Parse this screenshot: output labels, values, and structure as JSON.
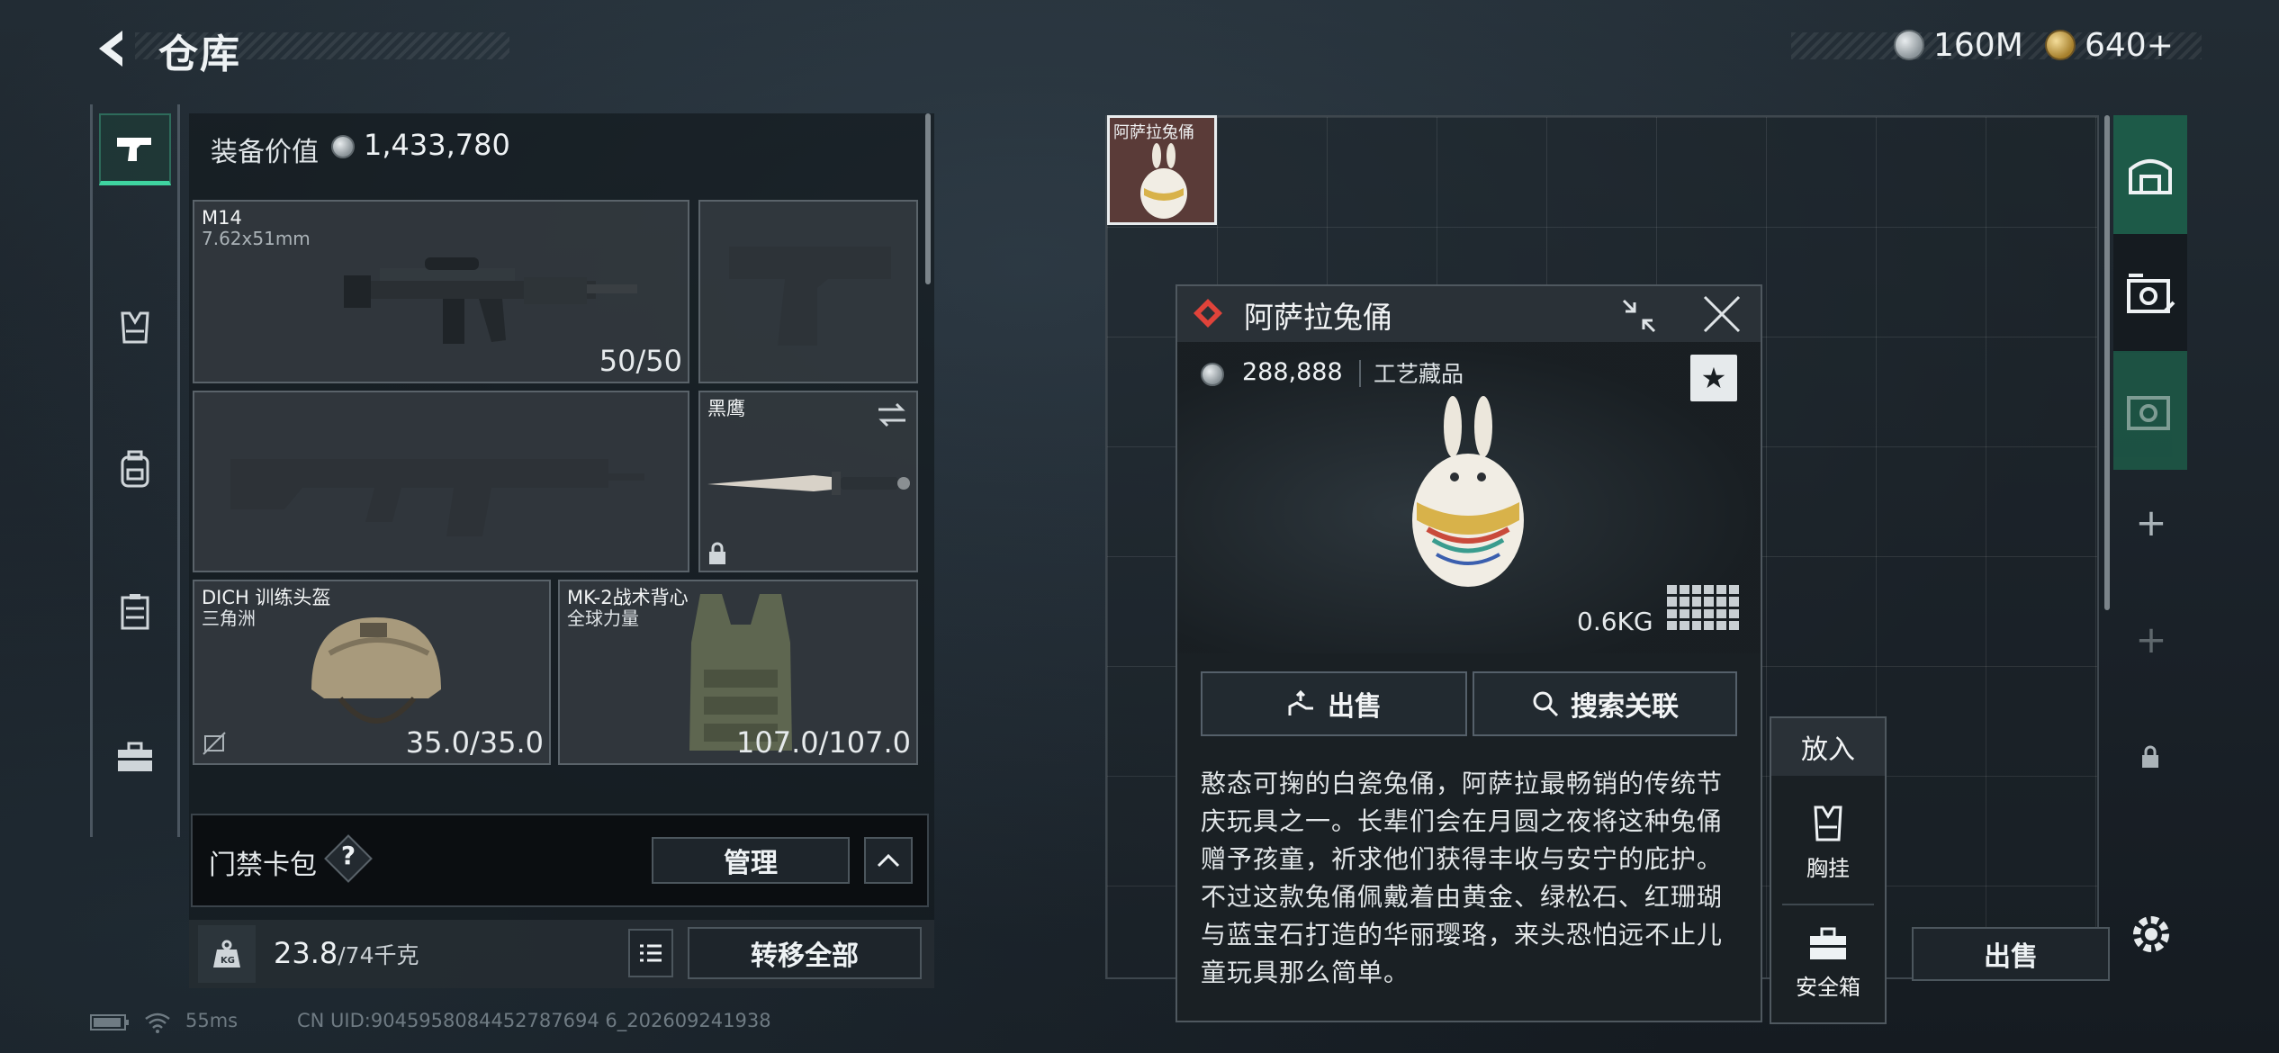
{
  "header": {
    "title": "仓库",
    "currencies": [
      {
        "icon": "silver-coin-icon",
        "value": "160M"
      },
      {
        "icon": "gold-coin-icon",
        "value": "640+"
      }
    ]
  },
  "left_rail": {
    "tabs": [
      "pistol-icon",
      "chest-rig-icon",
      "backpack-icon",
      "vest-pouch-icon",
      "toolbox-icon"
    ],
    "active": 0
  },
  "equipment": {
    "value_label": "装备价值",
    "value": "1,433,780",
    "primary_weapon": {
      "name": "M14",
      "caliber": "7.62x51mm",
      "ammo": "50/50"
    },
    "melee": {
      "name": "黑鹰",
      "locked": true
    },
    "helmet": {
      "name": "DICH 训练头盔",
      "faction": "三角洲",
      "durability": "35.0/35.0"
    },
    "armor": {
      "name": "MK-2战术背心",
      "faction": "全球力量",
      "durability": "107.0/107.0"
    }
  },
  "keycard": {
    "label": "门禁卡包",
    "help": "?",
    "manage": "管理"
  },
  "bottom": {
    "weight_current": "23.8",
    "weight_max": "/74千克",
    "transfer_all": "转移全部"
  },
  "status": {
    "ping": "55ms",
    "uid": "CN UID:9045958084452787694 6_202609241938"
  },
  "stash": {
    "item_label": "阿萨拉兔俑",
    "sell_label": "出售"
  },
  "popup": {
    "title": "阿萨拉兔俑",
    "price": "288,888",
    "category": "工艺藏品",
    "weight": "0.6KG",
    "sell": "出售",
    "search": "搜索关联",
    "description": "憨态可掬的白瓷兔俑，阿萨拉最畅销的传统节庆玩具之一。长辈们会在月圆之夜将这种兔俑赠予孩童，祈求他们获得丰收与安宁的庇护。不过这款兔俑佩戴着由黄金、绿松石、红珊瑚与蓝宝石打造的华丽璎珞，来头恐怕远不止儿童玩具那么简单。"
  },
  "put_in": {
    "title": "放入",
    "options": [
      "胸挂",
      "安全箱"
    ]
  },
  "colors": {
    "accent_green": "#3fd4a0",
    "rarity_red": "#e0433a",
    "tab_green": "#1d5a48"
  }
}
